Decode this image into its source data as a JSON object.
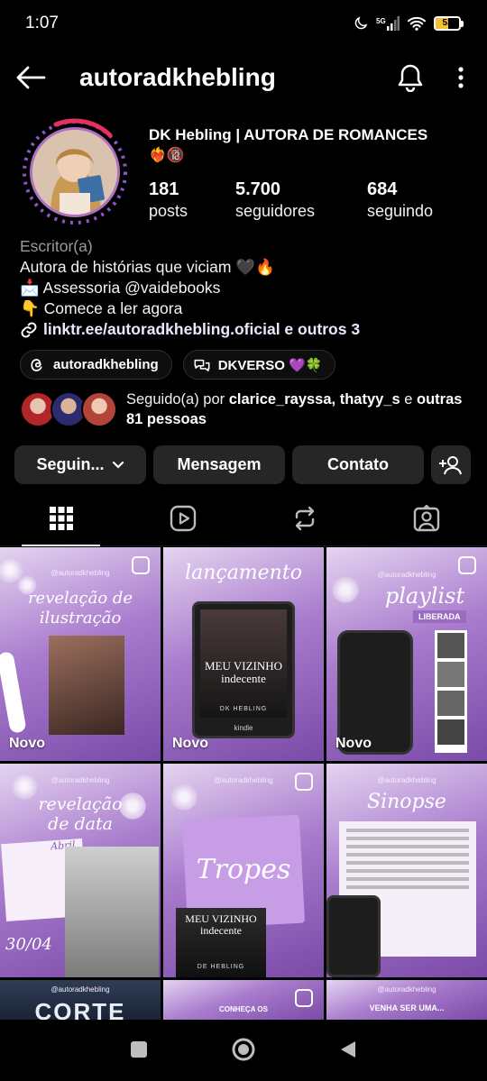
{
  "status_bar": {
    "time": "1:07",
    "battery": "53",
    "network": "5G"
  },
  "header": {
    "username": "autoradkhebling"
  },
  "profile": {
    "display_name": "DK Hebling | AUTORA DE ROMANCES",
    "emojis": "❤️‍🔥🔞",
    "stats": [
      {
        "value": "181",
        "label": "posts"
      },
      {
        "value": "5.700",
        "label": "seguidores"
      },
      {
        "value": "684",
        "label": "seguindo"
      }
    ],
    "category": "Escritor(a)",
    "bio_lines": [
      "Autora de histórias que viciam 🖤🔥",
      "📩 Assessoria @vaidebooks",
      "👇 Comece a ler agora"
    ],
    "link": "linktr.ee/autoradkhebling.oficial e outros 3",
    "chips": [
      {
        "label": "autoradkhebling",
        "icon": "threads-icon"
      },
      {
        "label": "DKVERSO 💜🍀",
        "icon": "chat-bubbles-icon"
      }
    ],
    "followed_by": {
      "prefix": "Seguido(a) por ",
      "names": "clarice_rayssa, thatyy_s",
      "connector": " e ",
      "others": "outras 81 pessoas"
    }
  },
  "actions": {
    "following": "Seguin...",
    "message": "Mensagem",
    "contact": "Contato"
  },
  "tabs": [
    {
      "name": "grid",
      "icon": "grid-icon",
      "active": true
    },
    {
      "name": "reels",
      "icon": "reels-icon",
      "active": false
    },
    {
      "name": "reposts",
      "icon": "repost-icon",
      "active": false
    },
    {
      "name": "tagged",
      "icon": "tagged-icon",
      "active": false
    }
  ],
  "posts": [
    {
      "handle": "@autoradkhebling",
      "title": "revelação de ilustração",
      "badge": "Novo",
      "multi": true
    },
    {
      "handle": "",
      "title": "lançamento",
      "badge": "Novo",
      "multi": false,
      "book": "MEU VIZINHO indecente",
      "author": "DK HEBLING",
      "device": "kindle"
    },
    {
      "handle": "@autoradkhebling",
      "title": "playlist",
      "subtitle": "LIBERADA",
      "badge": "Novo",
      "multi": true
    },
    {
      "handle": "@autoradkhebling",
      "title": "revelação de data",
      "date": "30/04",
      "month": "Abril",
      "multi": false
    },
    {
      "handle": "@autoradkhebling",
      "title": "Tropes",
      "book": "MEU VIZINHO indecente",
      "author": "DE HEBLING",
      "multi": true
    },
    {
      "handle": "@autoradkhebling",
      "title": "Sinopse",
      "multi": false
    },
    {
      "handle": "@autoradkhebling",
      "title": "CORTE",
      "multi": false
    },
    {
      "handle": "",
      "title": "CONHEÇA OS",
      "multi": true
    },
    {
      "handle": "@autoradkhebling",
      "title": "VENHA SER UMA...",
      "multi": false
    }
  ],
  "colors": {
    "accent_purple": "#a97ccd",
    "battery": "#f2c230",
    "button_bg": "#262626"
  }
}
